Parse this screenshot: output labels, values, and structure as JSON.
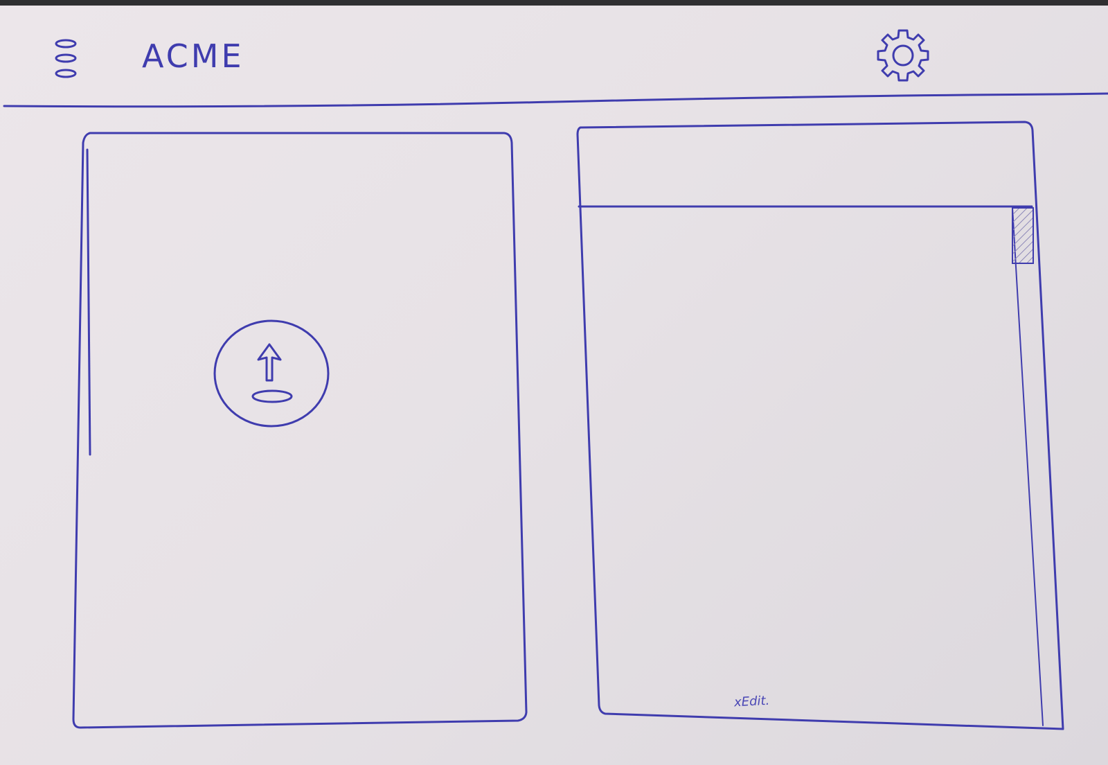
{
  "header": {
    "title": "ACME",
    "menu_icon": "hamburger-menu-icon",
    "settings_icon": "gear-icon"
  },
  "upload_panel": {
    "icon": "upload-icon"
  },
  "editor_panel": {
    "placeholder": "xEdit."
  },
  "colors": {
    "ink": "#3f3cae",
    "paper": "#e9e4e8"
  }
}
